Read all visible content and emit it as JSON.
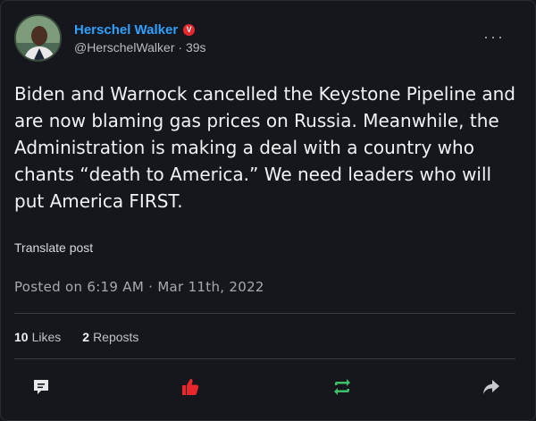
{
  "author": {
    "display_name": "Herschel Walker",
    "verified_badge": "V",
    "handle": "@HerschelWalker",
    "separator": " · ",
    "age": "39s"
  },
  "menu": {
    "more_label": "···"
  },
  "post": {
    "text": "Biden and Warnock cancelled the Keystone Pipeline and are now blaming gas prices on Russia. Meanwhile, the Administration is making a deal with a country who chants “death to America.” We need leaders who will put America FIRST.",
    "translate_label": "Translate post",
    "posted_label": "Posted on 6:19 AM · Mar 11th, 2022"
  },
  "stats": {
    "likes_count": "10",
    "likes_label": "Likes",
    "reposts_count": "2",
    "reposts_label": "Reposts"
  },
  "actions": [
    {
      "name": "comment-icon",
      "color": "#e8e9eb"
    },
    {
      "name": "like-icon",
      "color": "#e8272d"
    },
    {
      "name": "repost-icon",
      "color": "#3fbf6a"
    },
    {
      "name": "share-icon",
      "color": "#c8c9cc"
    }
  ],
  "colors": {
    "background": "#16171c",
    "name": "#2ea0ff",
    "verified": "#e8272d",
    "like": "#e8272d",
    "repost": "#3fbf6a"
  }
}
